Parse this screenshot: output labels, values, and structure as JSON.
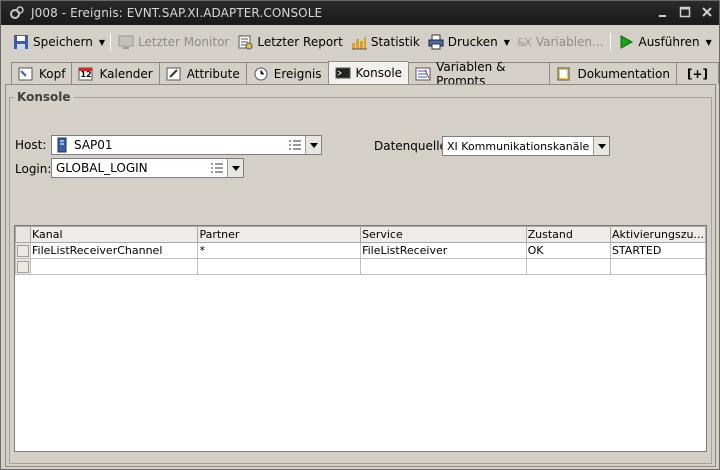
{
  "window": {
    "title": "J008 - Ereignis: EVNT.SAP.XI.ADAPTER.CONSOLE",
    "controls": [
      "minimize",
      "maximize",
      "close"
    ]
  },
  "toolbar": {
    "save": "Speichern",
    "last_monitor": "Letzter Monitor",
    "last_report": "Letzter Report",
    "statistics": "Statistik",
    "print": "Drucken",
    "variables": "Variablen...",
    "execute": "Ausführen"
  },
  "tabs": [
    {
      "label": "Kopf",
      "icon": "header-icon"
    },
    {
      "label": "Kalender",
      "icon": "calendar-icon"
    },
    {
      "label": "Attribute",
      "icon": "attribute-icon"
    },
    {
      "label": "Ereignis",
      "icon": "event-icon"
    },
    {
      "label": "Konsole",
      "icon": "console-icon",
      "active": true
    },
    {
      "label": "Variablen & Prompts",
      "icon": "variables-icon"
    },
    {
      "label": "Dokumentation",
      "icon": "documentation-icon"
    },
    {
      "label": "[+]",
      "icon": "add-tab-icon"
    }
  ],
  "calendar_icon_text": "12",
  "panel": {
    "group_title": "Konsole",
    "host_label": "Host:",
    "host_value": "SAP01",
    "login_label": "Login:",
    "login_value": "GLOBAL_LOGIN",
    "datasource_label": "Datenquelle:",
    "datasource_value": "XI Kommunikationskanäle"
  },
  "table": {
    "columns": [
      "Kanal",
      "Partner",
      "Service",
      "Zustand",
      "Aktivierungszu..."
    ],
    "rows": [
      [
        "FileListReceiverChannel",
        "*",
        "FileListReceiver",
        "OK",
        "STARTED"
      ],
      [
        "",
        "",
        "",
        "",
        ""
      ]
    ]
  },
  "colors": {
    "titlebar": "#1e1e1e",
    "window_bg": "#d4d0c8",
    "active_tab": "#f2f1ee",
    "execute_green": "#1aa31a"
  }
}
